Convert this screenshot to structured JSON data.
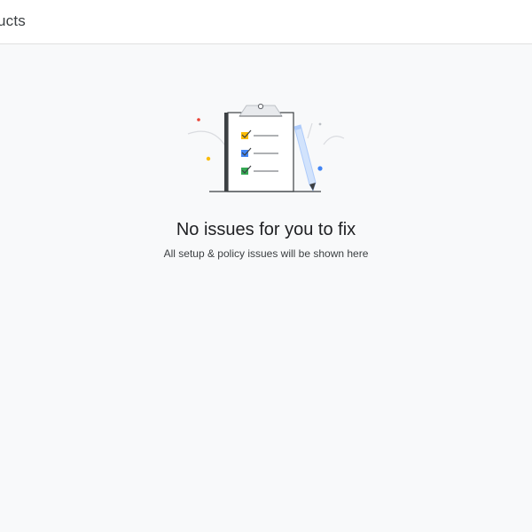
{
  "header": {
    "title": "ucts"
  },
  "empty_state": {
    "illustration_icon": "clipboard-checklist-illustration",
    "title": "No issues for you to fix",
    "subtitle": "All setup & policy issues will be shown here"
  },
  "colors": {
    "background": "#f8f9fa",
    "header_background": "#ffffff",
    "check_yellow": "#fbbc04",
    "check_blue": "#4285f4",
    "check_green": "#34a853",
    "dot_red": "#ea4335"
  }
}
